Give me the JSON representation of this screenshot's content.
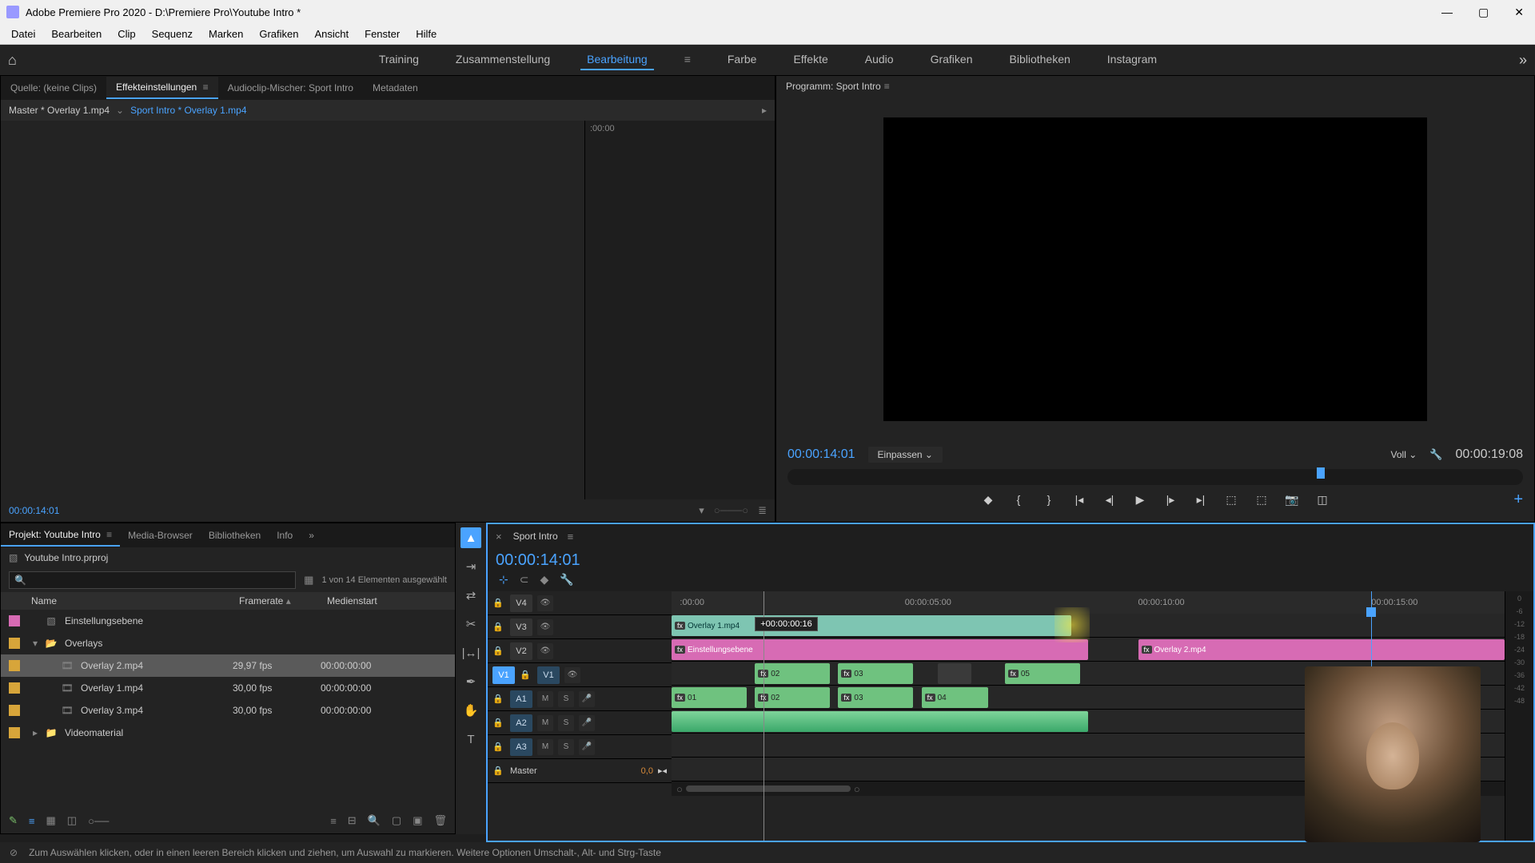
{
  "titlebar": {
    "app": "Adobe Premiere Pro 2020",
    "path": "D:\\Premiere Pro\\Youtube Intro *"
  },
  "menubar": [
    "Datei",
    "Bearbeiten",
    "Clip",
    "Sequenz",
    "Marken",
    "Grafiken",
    "Ansicht",
    "Fenster",
    "Hilfe"
  ],
  "workspace_tabs": [
    "Training",
    "Zusammenstellung",
    "Bearbeitung",
    "Farbe",
    "Effekte",
    "Audio",
    "Grafiken",
    "Bibliotheken",
    "Instagram"
  ],
  "workspace_active": 2,
  "source_tabs": [
    "Quelle: (keine Clips)",
    "Effekteinstellungen",
    "Audioclip-Mischer: Sport Intro",
    "Metadaten"
  ],
  "source_active": 1,
  "effect_controls": {
    "master": "Master * Overlay 1.mp4",
    "active": "Sport Intro * Overlay 1.mp4",
    "ruler_start": ":00:00",
    "time": "00:00:14:01"
  },
  "program": {
    "title": "Programm: Sport Intro",
    "time": "00:00:14:01",
    "fit": "Einpassen",
    "quality": "Voll",
    "duration": "00:00:19:08"
  },
  "project": {
    "tabs": [
      "Projekt: Youtube Intro",
      "Media-Browser",
      "Bibliotheken",
      "Info"
    ],
    "active": 0,
    "file": "Youtube Intro.prproj",
    "count": "1 von 14 Elementen ausgewählt",
    "headers": {
      "name": "Name",
      "framerate": "Framerate",
      "mediastart": "Medienstart"
    },
    "items": [
      {
        "swatch": "#d76bb4",
        "indent": 0,
        "icon": "adjustment",
        "name": "Einstellungsebene",
        "fr": "",
        "ms": "",
        "sel": false
      },
      {
        "swatch": "#d7a53a",
        "indent": 0,
        "icon": "folder-open",
        "name": "Overlays",
        "fr": "",
        "ms": "",
        "sel": false,
        "toggle": "▾"
      },
      {
        "swatch": "#d7a53a",
        "indent": 1,
        "icon": "clip",
        "name": "Overlay 2.mp4",
        "fr": "29,97 fps",
        "ms": "00:00:00:00",
        "sel": true
      },
      {
        "swatch": "#d7a53a",
        "indent": 1,
        "icon": "clip",
        "name": "Overlay 1.mp4",
        "fr": "30,00 fps",
        "ms": "00:00:00:00",
        "sel": false
      },
      {
        "swatch": "#d7a53a",
        "indent": 1,
        "icon": "clip",
        "name": "Overlay 3.mp4",
        "fr": "30,00 fps",
        "ms": "00:00:00:00",
        "sel": false
      },
      {
        "swatch": "#d7a53a",
        "indent": 0,
        "icon": "folder",
        "name": "Videomaterial",
        "fr": "",
        "ms": "",
        "sel": false,
        "toggle": "▸"
      }
    ]
  },
  "timeline": {
    "tab": "Sport Intro",
    "time": "00:00:14:01",
    "ruler": [
      ":00:00",
      "00:00:05:00",
      "00:00:10:00",
      "00:00:15:00"
    ],
    "ruler_pos": [
      0,
      28,
      56,
      84
    ],
    "playhead_pct": 84,
    "tracks": {
      "v4": {
        "label": "V4",
        "src": false
      },
      "v3": {
        "label": "V3",
        "src": false
      },
      "v2": {
        "label": "V2",
        "src": false
      },
      "v1": {
        "label": "V1",
        "src": true
      },
      "a1": {
        "label": "A1",
        "src": true
      },
      "a2": {
        "label": "A2",
        "src": false
      },
      "a3": {
        "label": "A3",
        "src": false
      },
      "master": {
        "label": "Master",
        "val": "0,0"
      }
    },
    "drag": {
      "tooltip": "+00:00:00:16"
    },
    "clips": {
      "v4_overlay1": "Overlay 1.mp4",
      "v3_adj": "Einstellungsebene",
      "v3_overlay2": "Overlay 2.mp4",
      "v2_02": "02",
      "v2_03": "03",
      "v2_05": "05",
      "v1_01": "01",
      "v1_02": "02",
      "v1_03": "03",
      "v1_04": "04"
    }
  },
  "audio_marks": [
    "0",
    "-6",
    "-12",
    "-18",
    "-24",
    "-30",
    "-36",
    "-42",
    "-48"
  ],
  "statusbar": "Zum Auswählen klicken, oder in einen leeren Bereich klicken und ziehen, um Auswahl zu markieren. Weitere Optionen Umschalt-, Alt- und Strg-Taste"
}
